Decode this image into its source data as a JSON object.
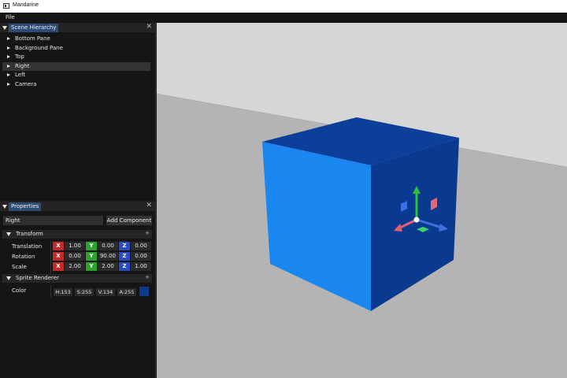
{
  "window": {
    "title": "Mandarine"
  },
  "menu": {
    "file": "File"
  },
  "hierarchy": {
    "tab_label": "Scene Hierarchy",
    "items": [
      {
        "label": "Bottom Pane"
      },
      {
        "label": "Background Pane"
      },
      {
        "label": "Top"
      },
      {
        "label": "Right",
        "selected": true
      },
      {
        "label": "Left"
      },
      {
        "label": "Camera"
      }
    ]
  },
  "properties": {
    "tab_label": "Properties",
    "entity_name": "Right",
    "add_component": "Add Component",
    "transform": {
      "title": "Transform",
      "rows": [
        {
          "label": "Translation",
          "x": "1.00",
          "y": "0.00",
          "z": "0.00"
        },
        {
          "label": "Rotation",
          "x": "0.00",
          "y": "90.00",
          "z": "0.00"
        },
        {
          "label": "Scale",
          "x": "2.00",
          "y": "2.00",
          "z": "1.00"
        }
      ],
      "axis_x": "X",
      "axis_y": "Y",
      "axis_z": "Z"
    },
    "sprite_renderer": {
      "title": "Sprite Renderer",
      "color_label": "Color",
      "h": "H:153",
      "s": "S:255",
      "v": "V:134",
      "a": "A:255",
      "swatch_color": "#0e3a8a"
    },
    "plus": "+"
  },
  "colors": {
    "cube_front": "#1a86f0",
    "cube_top": "#0b3f9a",
    "cube_side": "#0a3a8f",
    "sky": "#d6d6d6",
    "floor": "#b4b4b4"
  }
}
